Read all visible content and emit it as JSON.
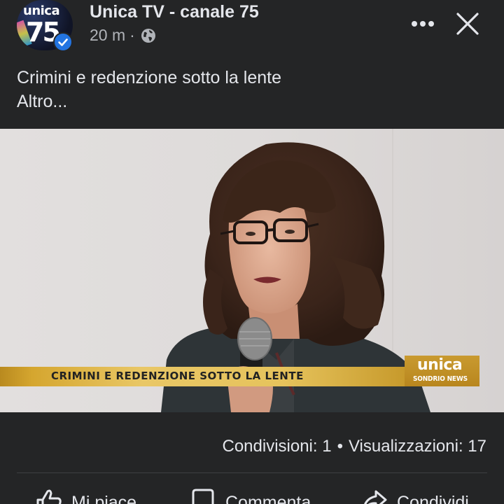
{
  "header": {
    "page_name": "Unica TV - canale 75",
    "time": "20 m",
    "dot": "·",
    "privacy_icon": "globe-icon",
    "verified_icon": "verified-badge-icon",
    "avatar": {
      "word": "unica",
      "number": "75"
    },
    "more_icon": "more-options-icon",
    "close_icon": "close-icon"
  },
  "post": {
    "text": "Crimini e redenzione sotto la lente",
    "see_more": "Altro..."
  },
  "video": {
    "lower_third": "CRIMINI E REDENZIONE SOTTO LA LENTE",
    "logo_word": "unica",
    "logo_sub": "SONDRIO NEWS",
    "accent_color": "#d5a62f"
  },
  "stats": {
    "shares": "Condivisioni: 1",
    "separator": "•",
    "views": "Visualizzazioni: 17"
  },
  "actions": {
    "like": {
      "label": "Mi piace",
      "icon": "thumbs-up-icon"
    },
    "comment": {
      "label": "Commenta",
      "icon": "comment-icon"
    },
    "share": {
      "label": "Condividi",
      "icon": "share-icon"
    }
  },
  "colors": {
    "background": "#242526",
    "text": "#e4e6eb",
    "secondary_text": "#b0b3b8",
    "verified": "#2374e1"
  }
}
